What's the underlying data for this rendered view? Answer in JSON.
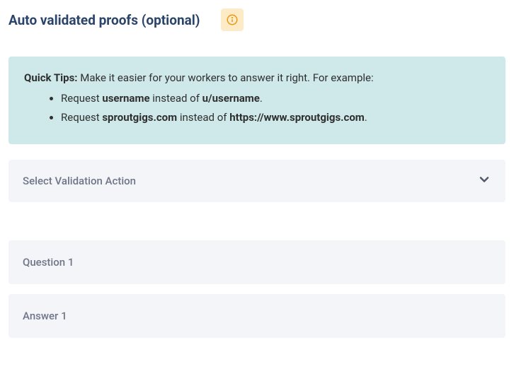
{
  "header": {
    "title": "Auto validated proofs (optional)"
  },
  "tips": {
    "heading": "Quick Tips:",
    "intro": " Make it easier for your workers to answer it right. For example:",
    "items": [
      {
        "prefix": "Request ",
        "bold1": "username",
        "mid": " instead of ",
        "bold2": "u/username",
        "suffix": "."
      },
      {
        "prefix": "Request ",
        "bold1": "sproutgigs.com",
        "mid": " instead of ",
        "bold2": "https://www.sproutgigs.com",
        "suffix": "."
      }
    ]
  },
  "validationSelect": {
    "label": "Select Validation Action"
  },
  "fields": {
    "question": {
      "placeholder": "Question 1",
      "value": ""
    },
    "answer": {
      "placeholder": "Answer 1",
      "value": ""
    }
  }
}
